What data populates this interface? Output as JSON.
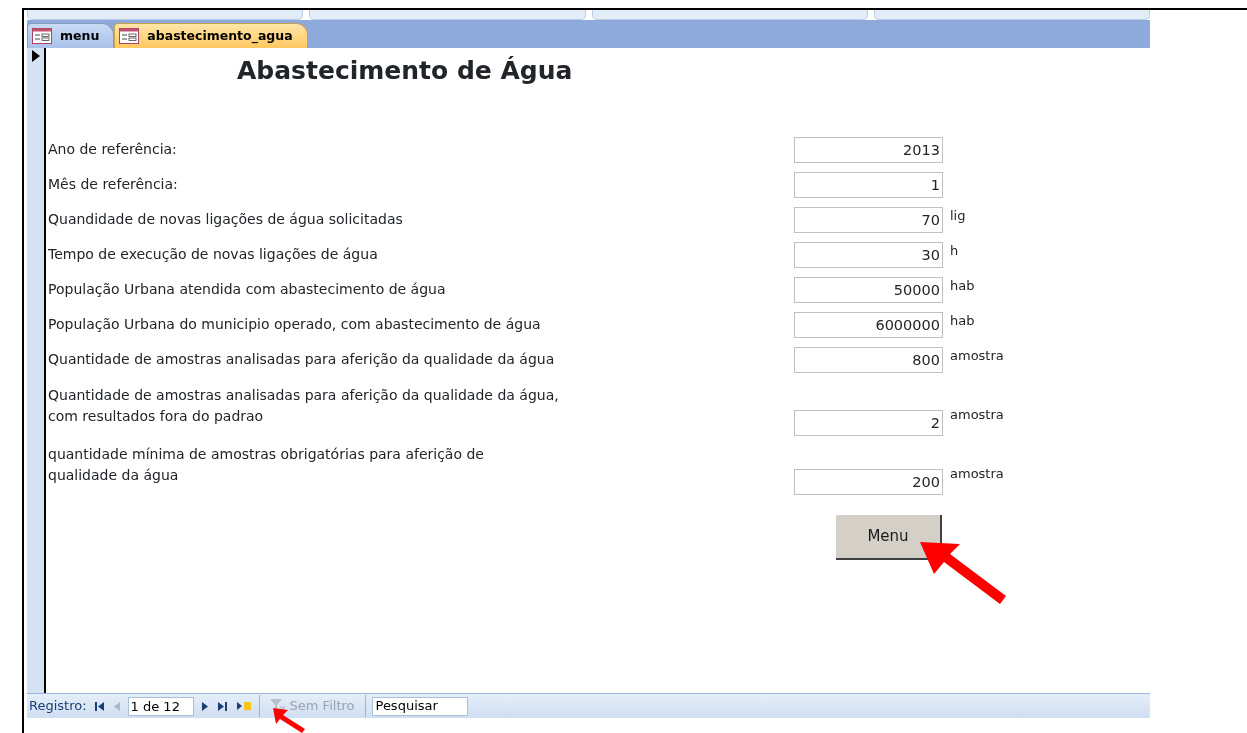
{
  "tabs": [
    {
      "label": "menu",
      "selected": false
    },
    {
      "label": "abastecimento_agua",
      "selected": true
    }
  ],
  "form": {
    "title": "Abastecimento de Água",
    "fields": [
      {
        "kind": "line",
        "label": "Ano de referência:",
        "value": "2013"
      },
      {
        "kind": "line",
        "label": "Mês de referência:",
        "value": "1"
      },
      {
        "kind": "line",
        "label": "Quandidade de novas ligações de água solicitadas",
        "value": "70",
        "unit": "lig"
      },
      {
        "kind": "line",
        "label": "Tempo de execução de novas ligações de água",
        "value": "30",
        "unit": "h"
      },
      {
        "kind": "line",
        "label": "População Urbana atendida com abastecimento de água",
        "value": "50000",
        "unit": "hab"
      },
      {
        "kind": "line",
        "label": "População Urbana do municipio operado, com abastecimento de água",
        "value": "6000000",
        "unit": "hab"
      },
      {
        "kind": "line",
        "label": "Quantidade de amostras analisadas para aferição da qualidade da água",
        "value": "800",
        "unit": "amostra"
      },
      {
        "kind": "wrapped",
        "label": "Quantidade de amostras analisadas para aferição da qualidade da água,\ncom resultados fora do padrao",
        "value": "2",
        "unit": "amostra"
      },
      {
        "kind": "wrapped",
        "label": "quantidade mínima de amostras obrigatórias para aferição de\nqualidade da água",
        "value": "200",
        "unit": "amostra"
      }
    ],
    "button": "Menu"
  },
  "navigation": {
    "label": "Registro:",
    "record": "1 de 12",
    "filter": "Sem Filtro",
    "search_placeholder": "Pesquisar"
  }
}
